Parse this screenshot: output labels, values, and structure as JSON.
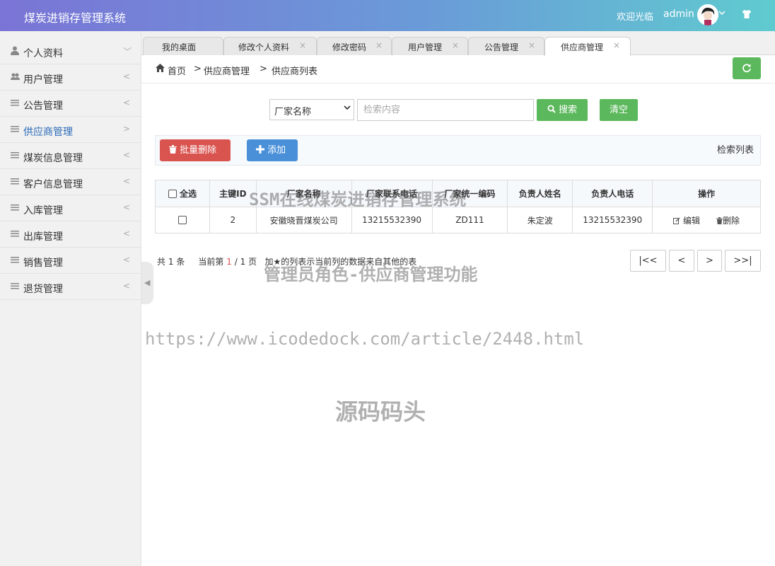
{
  "header": {
    "app_title": "煤炭进销存管理系统",
    "welcome": "欢迎光临",
    "user": "admin"
  },
  "sidebar": {
    "items": [
      {
        "label": "个人资料",
        "icon": "user-icon",
        "arrow": "﹀"
      },
      {
        "label": "用户管理",
        "icon": "users-icon",
        "arrow": "<"
      },
      {
        "label": "公告管理",
        "icon": "list-icon",
        "arrow": "<"
      },
      {
        "label": "供应商管理",
        "icon": "list-icon",
        "arrow": ">",
        "active": true
      },
      {
        "label": "煤炭信息管理",
        "icon": "list-icon",
        "arrow": "<"
      },
      {
        "label": "客户信息管理",
        "icon": "list-icon",
        "arrow": "<"
      },
      {
        "label": "入库管理",
        "icon": "list-icon",
        "arrow": "<"
      },
      {
        "label": "出库管理",
        "icon": "list-icon",
        "arrow": "<"
      },
      {
        "label": "销售管理",
        "icon": "list-icon",
        "arrow": "<"
      },
      {
        "label": "退货管理",
        "icon": "list-icon",
        "arrow": "<"
      }
    ]
  },
  "tabs": [
    {
      "label": "我的桌面"
    },
    {
      "label": "修改个人资料",
      "close": "×"
    },
    {
      "label": "修改密码",
      "close": "×"
    },
    {
      "label": "用户管理",
      "close": "×"
    },
    {
      "label": "公告管理",
      "close": "×"
    },
    {
      "label": "供应商管理",
      "close": "×",
      "active": true
    }
  ],
  "breadcrumb": {
    "home": "首页",
    "sep1": ">",
    "level1": "供应商管理",
    "sep2": ">",
    "level2": "供应商列表"
  },
  "search": {
    "field_selected": "厂家名称",
    "placeholder": "检索内容",
    "search_label": "搜索",
    "clear_label": "清空"
  },
  "toolbar": {
    "batch_delete_label": "批量删除",
    "add_label": "添加",
    "title": "检索列表"
  },
  "table": {
    "headers": {
      "select_all": "全选",
      "id": "主键ID",
      "name": "厂家名称",
      "phone": "厂家联系电话",
      "code": "厂家统一编码",
      "contact_name": "负责人姓名",
      "contact_phone": "负责人电话",
      "actions": "操作"
    },
    "rows": [
      {
        "id": "2",
        "name": "安徽晓晋煤炭公司",
        "phone": "13215532390",
        "code": "ZD111",
        "contact_name": "朱定波",
        "contact_phone": "13215532390",
        "edit": "编辑",
        "delete": "删除"
      }
    ]
  },
  "pagination": {
    "total_prefix": "共",
    "total": "1",
    "total_suffix": "条",
    "current_prefix": "当前第",
    "current": "1",
    "separator": "/",
    "pages": "1",
    "pages_suffix": "页",
    "note": "加★的列表示当前列的数据来自其他的表",
    "first": "|<<",
    "prev": "<",
    "next": ">",
    "last": ">>|"
  },
  "watermarks": {
    "line1": "SSM在线煤炭进销存管理系统",
    "line2": "管理员角色-供应商管理功能",
    "url": "https://www.icodedock.com/article/2448.html",
    "brand": "源码码头"
  }
}
